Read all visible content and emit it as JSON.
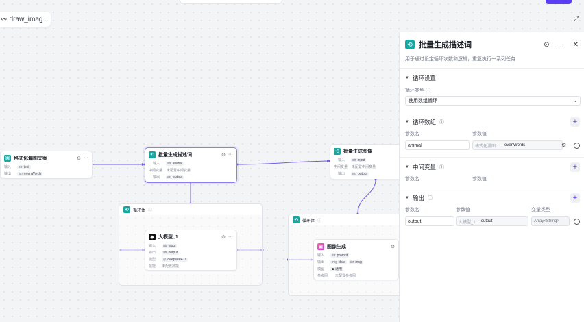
{
  "workflow": {
    "title": "draw_imag..."
  },
  "nodes": {
    "format_text": {
      "title": "格式化漏图文案",
      "rows": [
        {
          "label": "输入",
          "tag": "text",
          "value": ""
        },
        {
          "label": "输出",
          "tag": "evenWords",
          "value": ""
        }
      ]
    },
    "batch_desc": {
      "title": "批量生成描述词",
      "rows": [
        {
          "label": "输入",
          "tag": "animal",
          "value": ""
        },
        {
          "label": "中间变量",
          "tag": "",
          "value": "未配置中间变量"
        },
        {
          "label": "输出",
          "tag": "output",
          "value": ""
        }
      ]
    },
    "batch_image": {
      "title": "批量生成图像",
      "rows": [
        {
          "label": "输入",
          "tag": "input",
          "value": ""
        },
        {
          "label": "中间变量",
          "tag": "",
          "value": "未配置中间变量"
        },
        {
          "label": "输出",
          "tag": "output",
          "value": ""
        }
      ]
    },
    "loop1": {
      "title": "循环体"
    },
    "llm": {
      "title": "大模型_1",
      "rows": [
        {
          "label": "输入",
          "tag": "input",
          "value": ""
        },
        {
          "label": "输出",
          "tag": "output",
          "value": ""
        },
        {
          "label": "模型",
          "tag": "deepseek-r1",
          "value": ""
        },
        {
          "label": "技能",
          "tag": "",
          "value": "未配置技能"
        }
      ]
    },
    "loop2": {
      "title": "循环体"
    },
    "image_gen": {
      "title": "图像生成",
      "rows": [
        {
          "label": "输入",
          "tag": "prompt",
          "value": ""
        },
        {
          "label": "输出",
          "tag": "data",
          "value": "msg"
        },
        {
          "label": "模型",
          "tag": "通用",
          "value": ""
        },
        {
          "label": "参考图",
          "tag": "",
          "value": "未配置参考图"
        }
      ]
    }
  },
  "panel": {
    "title": "批量生成描述词",
    "description": "用于通过设定循环次数和逻辑，重复执行一系列任务",
    "loop_settings": {
      "title": "循环设置",
      "type_label": "循环类型",
      "type_value": "使用数组循环"
    },
    "loop_array": {
      "title": "循环数组",
      "col_name": "参数名",
      "col_value": "参数值",
      "name": "animal",
      "ref_source": "格式化漏图...",
      "ref_var": "evenWords"
    },
    "intermediate": {
      "title": "中间变量",
      "col_name": "参数名",
      "col_value": "参数值"
    },
    "output": {
      "title": "输出",
      "col_name": "参数名",
      "col_value": "参数值",
      "col_type": "变量类型",
      "name": "output",
      "ref_source": "大模型_1",
      "ref_var": "output",
      "type": "Array<String>"
    }
  }
}
